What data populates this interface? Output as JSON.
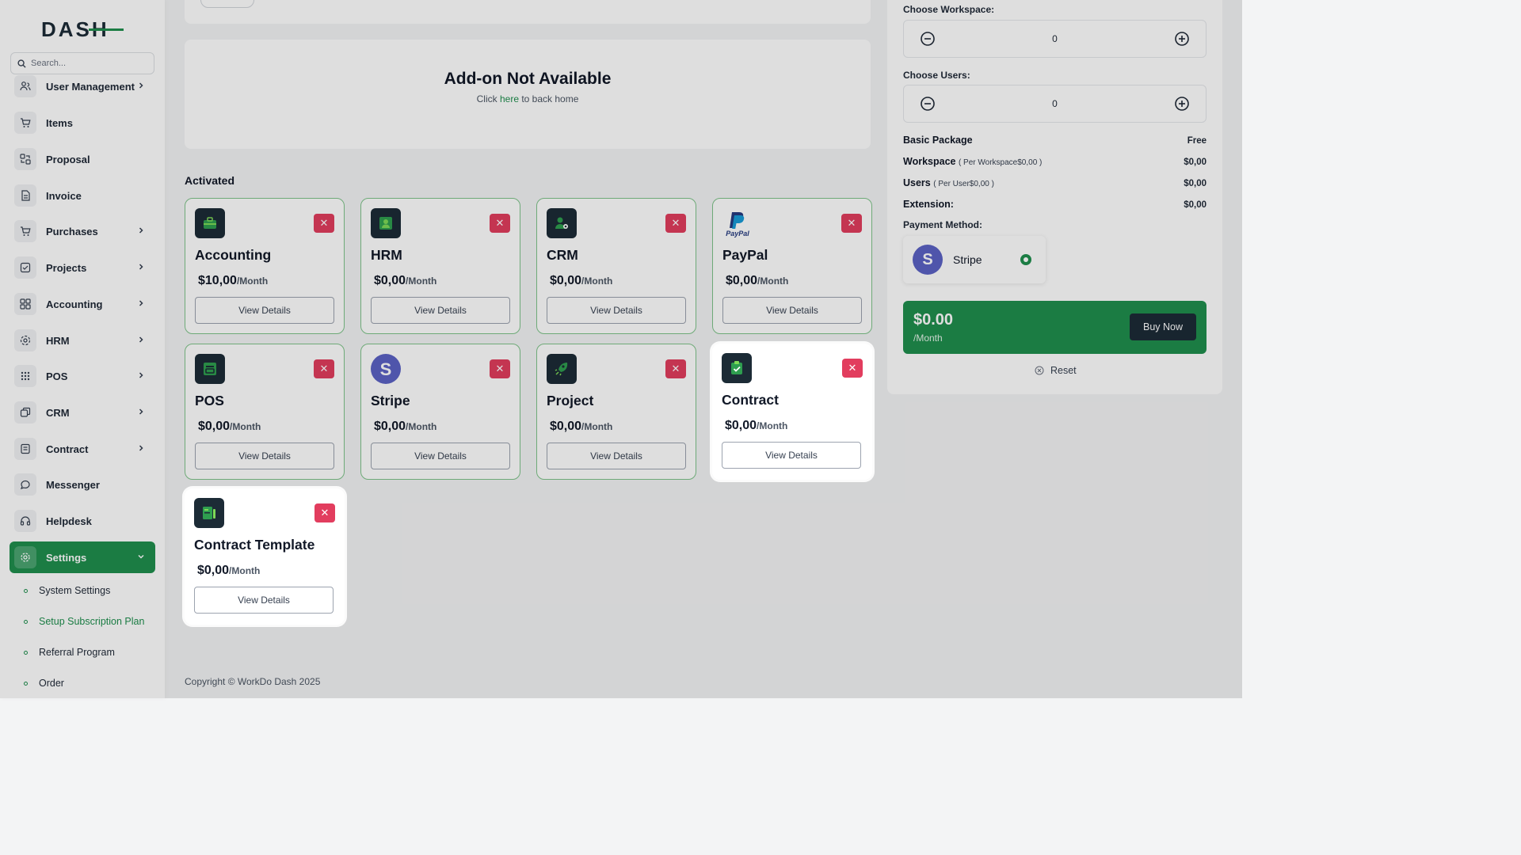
{
  "sidebar": {
    "logo": "DASH",
    "search_placeholder": "Search...",
    "items": [
      {
        "label": "User Management",
        "icon": "users-icon",
        "chevron": true
      },
      {
        "label": "Items",
        "icon": "cart-icon",
        "chevron": false
      },
      {
        "label": "Proposal",
        "icon": "proposal-icon",
        "chevron": false
      },
      {
        "label": "Invoice",
        "icon": "invoice-icon",
        "chevron": false
      },
      {
        "label": "Purchases",
        "icon": "cart-icon",
        "chevron": true
      },
      {
        "label": "Projects",
        "icon": "check-square-icon",
        "chevron": true
      },
      {
        "label": "Accounting",
        "icon": "grid-icon",
        "chevron": true
      },
      {
        "label": "HRM",
        "icon": "hrm-icon",
        "chevron": true
      },
      {
        "label": "POS",
        "icon": "dots-grid-icon",
        "chevron": true
      },
      {
        "label": "CRM",
        "icon": "crm-icon",
        "chevron": true
      },
      {
        "label": "Contract",
        "icon": "contract-icon",
        "chevron": true
      },
      {
        "label": "Messenger",
        "icon": "message-icon",
        "chevron": false
      },
      {
        "label": "Helpdesk",
        "icon": "headset-icon",
        "chevron": false
      },
      {
        "label": "Settings",
        "icon": "gear-icon",
        "chevron": true,
        "active": true
      }
    ],
    "sub_items": [
      {
        "label": "System Settings",
        "active": false
      },
      {
        "label": "Setup Subscription Plan",
        "active": true
      },
      {
        "label": "Referral Program",
        "active": false
      },
      {
        "label": "Order",
        "active": false
      }
    ]
  },
  "main": {
    "not_available": {
      "title": "Add-on Not Available",
      "sub_prefix": "Click ",
      "sub_link": "here",
      "sub_suffix": " to back home"
    },
    "activated_title": "Activated",
    "cards": [
      {
        "name": "Accounting",
        "price": "$10,00",
        "per": "/Month",
        "button": "View Details",
        "icon": "accounting-icon"
      },
      {
        "name": "HRM",
        "price": "$0,00",
        "per": "/Month",
        "button": "View Details",
        "icon": "hrm-icon"
      },
      {
        "name": "CRM",
        "price": "$0,00",
        "per": "/Month",
        "button": "View Details",
        "icon": "crm-icon"
      },
      {
        "name": "PayPal",
        "price": "$0,00",
        "per": "/Month",
        "button": "View Details",
        "icon": "paypal-icon"
      },
      {
        "name": "POS",
        "price": "$0,00",
        "per": "/Month",
        "button": "View Details",
        "icon": "pos-icon"
      },
      {
        "name": "Stripe",
        "price": "$0,00",
        "per": "/Month",
        "button": "View Details",
        "icon": "stripe-icon"
      },
      {
        "name": "Project",
        "price": "$0,00",
        "per": "/Month",
        "button": "View Details",
        "icon": "project-icon"
      },
      {
        "name": "Contract",
        "price": "$0,00",
        "per": "/Month",
        "button": "View Details",
        "icon": "contract-icon"
      },
      {
        "name": "Contract Template",
        "price": "$0,00",
        "per": "/Month",
        "button": "View Details",
        "icon": "contract-template-icon"
      }
    ],
    "close_symbol": "✕",
    "footer": "Copyright © WorkDo Dash 2025"
  },
  "right_panel": {
    "workspace_label": "Choose Workspace:",
    "workspace_value": "0",
    "users_label": "Choose Users:",
    "users_value": "0",
    "summary": [
      {
        "key": "Basic Package",
        "note": "",
        "value": "Free"
      },
      {
        "key": "Workspace",
        "note": "( Per Workspace$0,00 )",
        "value": "$0,00"
      },
      {
        "key": "Users",
        "note": "( Per User$0,00 )",
        "value": "$0,00"
      },
      {
        "key": "Extension:",
        "note": "",
        "value": "$0,00"
      }
    ],
    "payment_label": "Payment Method:",
    "payment_method": {
      "logo": "S",
      "name": "Stripe"
    },
    "total": "$0.00",
    "total_per": "/Month",
    "buy_label": "Buy Now",
    "reset_label": "Reset"
  },
  "colors": {
    "brand": "#1f8f4e",
    "danger": "#e23d5e",
    "dark": "#1c2b36",
    "stripe": "#5b62c5"
  }
}
